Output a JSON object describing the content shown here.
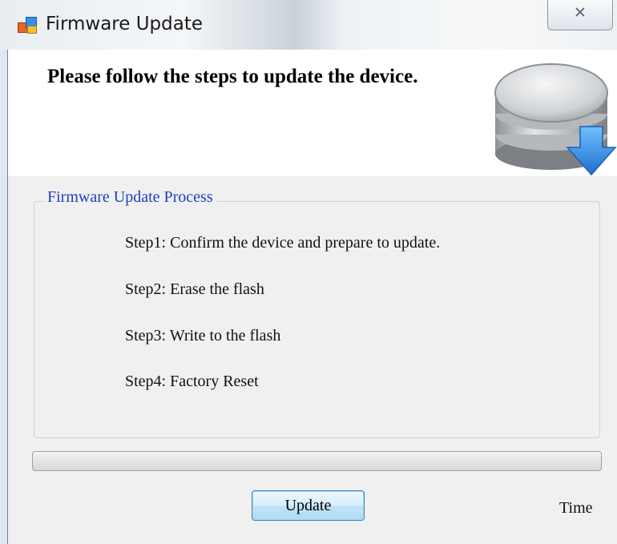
{
  "window": {
    "title": "Firmware Update",
    "close_glyph": "☒"
  },
  "header": {
    "instruction": "Please follow the steps to update the device.",
    "icon": "database-download-icon"
  },
  "group": {
    "label": "Firmware Update Process",
    "steps": [
      "Step1: Confirm the device and prepare to update.",
      "Step2: Erase the flash",
      "Step3: Write to the flash",
      "Step4: Factory Reset"
    ]
  },
  "progress": {
    "fraction": 0
  },
  "footer": {
    "update_label": "Update",
    "time_label": "Time"
  },
  "colors": {
    "group_label": "#1f3fbf",
    "accent_blue": "#2a8be0"
  }
}
